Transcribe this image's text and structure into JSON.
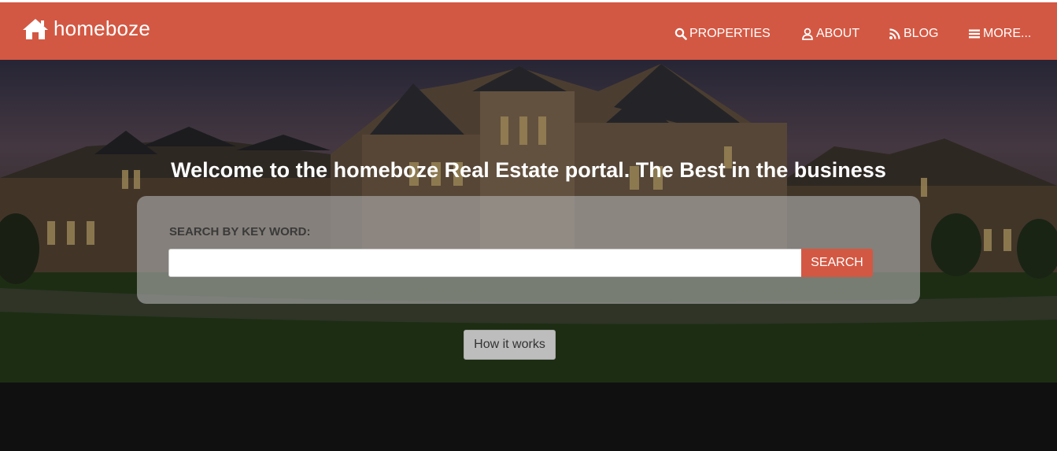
{
  "brand": {
    "name": "homeboze",
    "icon": "home-icon"
  },
  "nav": {
    "items": [
      {
        "label": "PROPERTIES",
        "icon": "search-icon"
      },
      {
        "label": "ABOUT",
        "icon": "user-icon"
      },
      {
        "label": "BLOG",
        "icon": "rss-icon"
      },
      {
        "label": "MORE...",
        "icon": "menu-icon"
      }
    ]
  },
  "hero": {
    "headline": "Welcome to the homeboze Real Estate portal. The Best in the business",
    "search_label": "SEARCH BY KEY WORD:",
    "search_value": "",
    "search_button": "SEARCH",
    "how_button": "How it works"
  },
  "colors": {
    "brand": "#d35843",
    "panel": "rgba(175,175,175,0.62)",
    "button_secondary": "#bdbdbd"
  }
}
